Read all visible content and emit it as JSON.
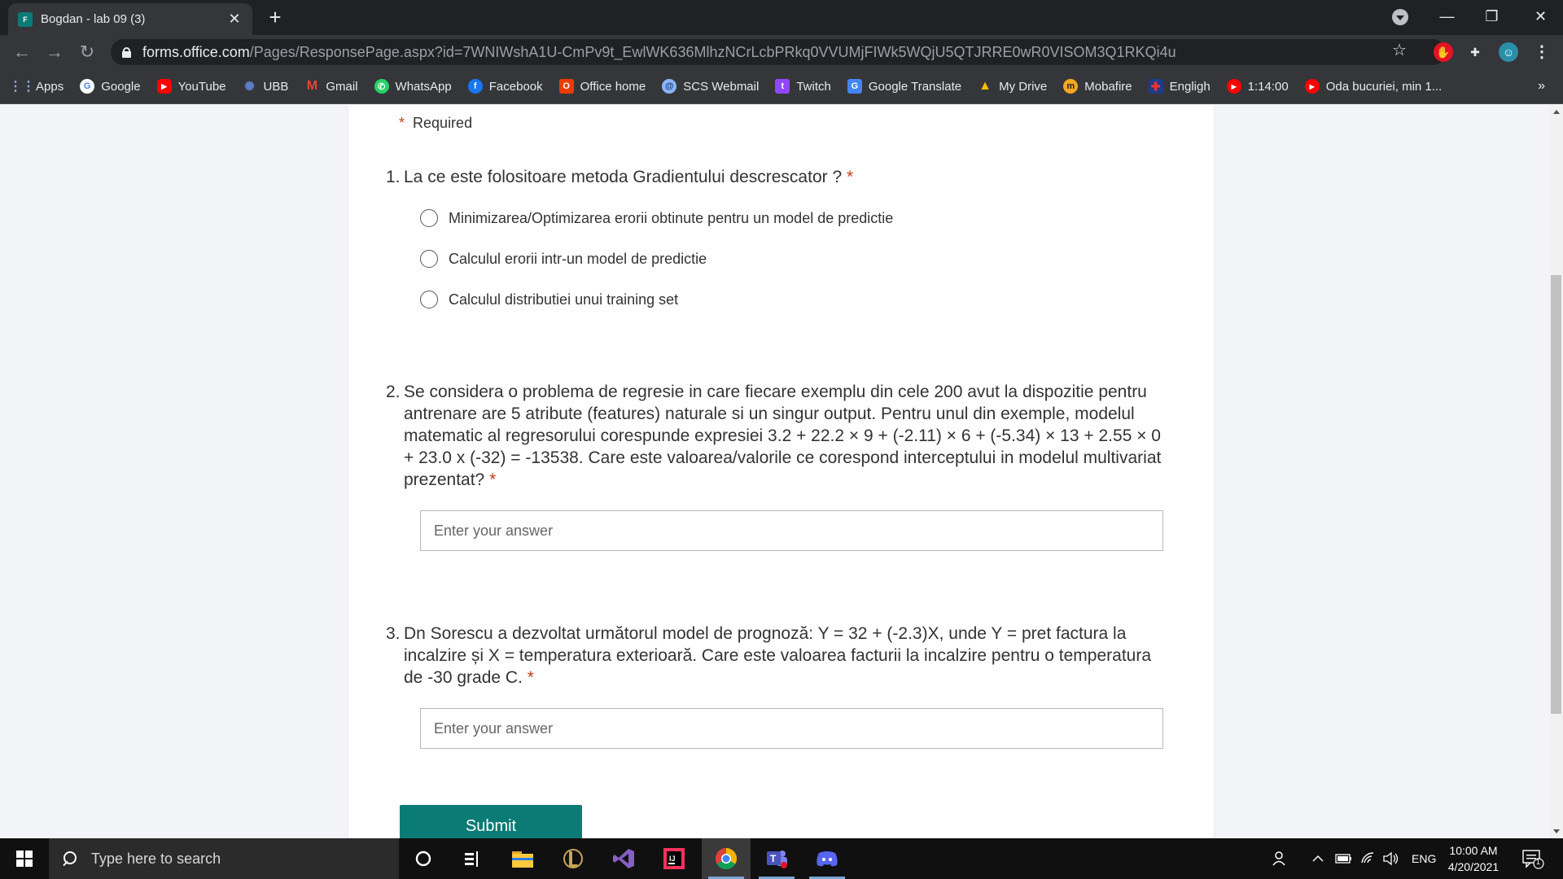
{
  "browser": {
    "tab_title": "Bogdan - lab 09 (3)",
    "tab_favicon_text": "F",
    "url_host": "forms.office.com",
    "url_path": "/Pages/ResponsePage.aspx?id=7WNIWshA1U-CmPv9t_EwlWK636MlhzNCrLcbPRkq0VVUMjFIWk5WQjU5QTJRRE0wR0VISOM3Q1RKQi4u",
    "bookmarks": [
      {
        "label": "Apps",
        "icon": "apps-grid-icon"
      },
      {
        "label": "Google",
        "icon": "google-icon"
      },
      {
        "label": "YouTube",
        "icon": "youtube-icon"
      },
      {
        "label": "UBB",
        "icon": "ubb-icon"
      },
      {
        "label": "Gmail",
        "icon": "gmail-icon"
      },
      {
        "label": "WhatsApp",
        "icon": "whatsapp-icon"
      },
      {
        "label": "Facebook",
        "icon": "facebook-icon"
      },
      {
        "label": "Office home",
        "icon": "office-icon"
      },
      {
        "label": "SCS Webmail",
        "icon": "webmail-icon"
      },
      {
        "label": "Twitch",
        "icon": "twitch-icon"
      },
      {
        "label": "Google Translate",
        "icon": "translate-icon"
      },
      {
        "label": "My Drive",
        "icon": "drive-icon"
      },
      {
        "label": "Mobafire",
        "icon": "mobafire-icon"
      },
      {
        "label": "Engligh",
        "icon": "uk-flag-icon"
      },
      {
        "label": "1:14:00",
        "icon": "youtube-icon"
      },
      {
        "label": "Oda bucuriei, min 1...",
        "icon": "youtube-icon"
      }
    ],
    "bookmarks_more": "»"
  },
  "form": {
    "required_note": "Required",
    "asterisk": "*",
    "questions": [
      {
        "number": "1.",
        "text": "La ce este folositoare metoda Gradientului descrescator ?",
        "options": [
          "Minimizarea/Optimizarea erorii obtinute pentru un model de predictie",
          "Calculul erorii intr-un model de predictie",
          "Calculul distributiei unui training set"
        ]
      },
      {
        "number": "2.",
        "text": "Se considera o problema de regresie in care fiecare exemplu din cele 200 avut la dispozitie pentru antrenare are 5 atribute (features) naturale si un singur output. Pentru unul din exemple, modelul matematic al regresorului corespunde expresiei 3.2 + 22.2 × 9 + (-2.11) × 6 + (-5.34) × 13 + 2.55 × 0 + 23.0 x (-32) = -13538. Care este valoarea/valorile ce corespond interceptului in modelul multivariat prezentat?",
        "placeholder": "Enter your answer"
      },
      {
        "number": "3.",
        "text": "Dn Sorescu a dezvoltat următorul model de prognoză: Y = 32 + (-2.3)X, unde Y = pret factura la incalzire și X = temperatura exterioară. Care este valoarea facturii la incalzire pentru o temperatura de -30 grade C.",
        "placeholder": "Enter your answer"
      }
    ],
    "submit_label": "Submit"
  },
  "taskbar": {
    "search_placeholder": "Type here to search",
    "apps": [
      "cortana-icon",
      "task-view-icon",
      "file-explorer-icon",
      "league-icon",
      "visual-studio-icon",
      "intellij-icon",
      "chrome-icon",
      "teams-icon",
      "discord-icon"
    ],
    "language": "ENG",
    "time": "10:00 AM",
    "date": "4/20/2021",
    "notification_count": "1"
  },
  "colors": {
    "accent": "#0b7b75",
    "required": "#c43e1c",
    "page_bg": "#f2f4f7"
  }
}
